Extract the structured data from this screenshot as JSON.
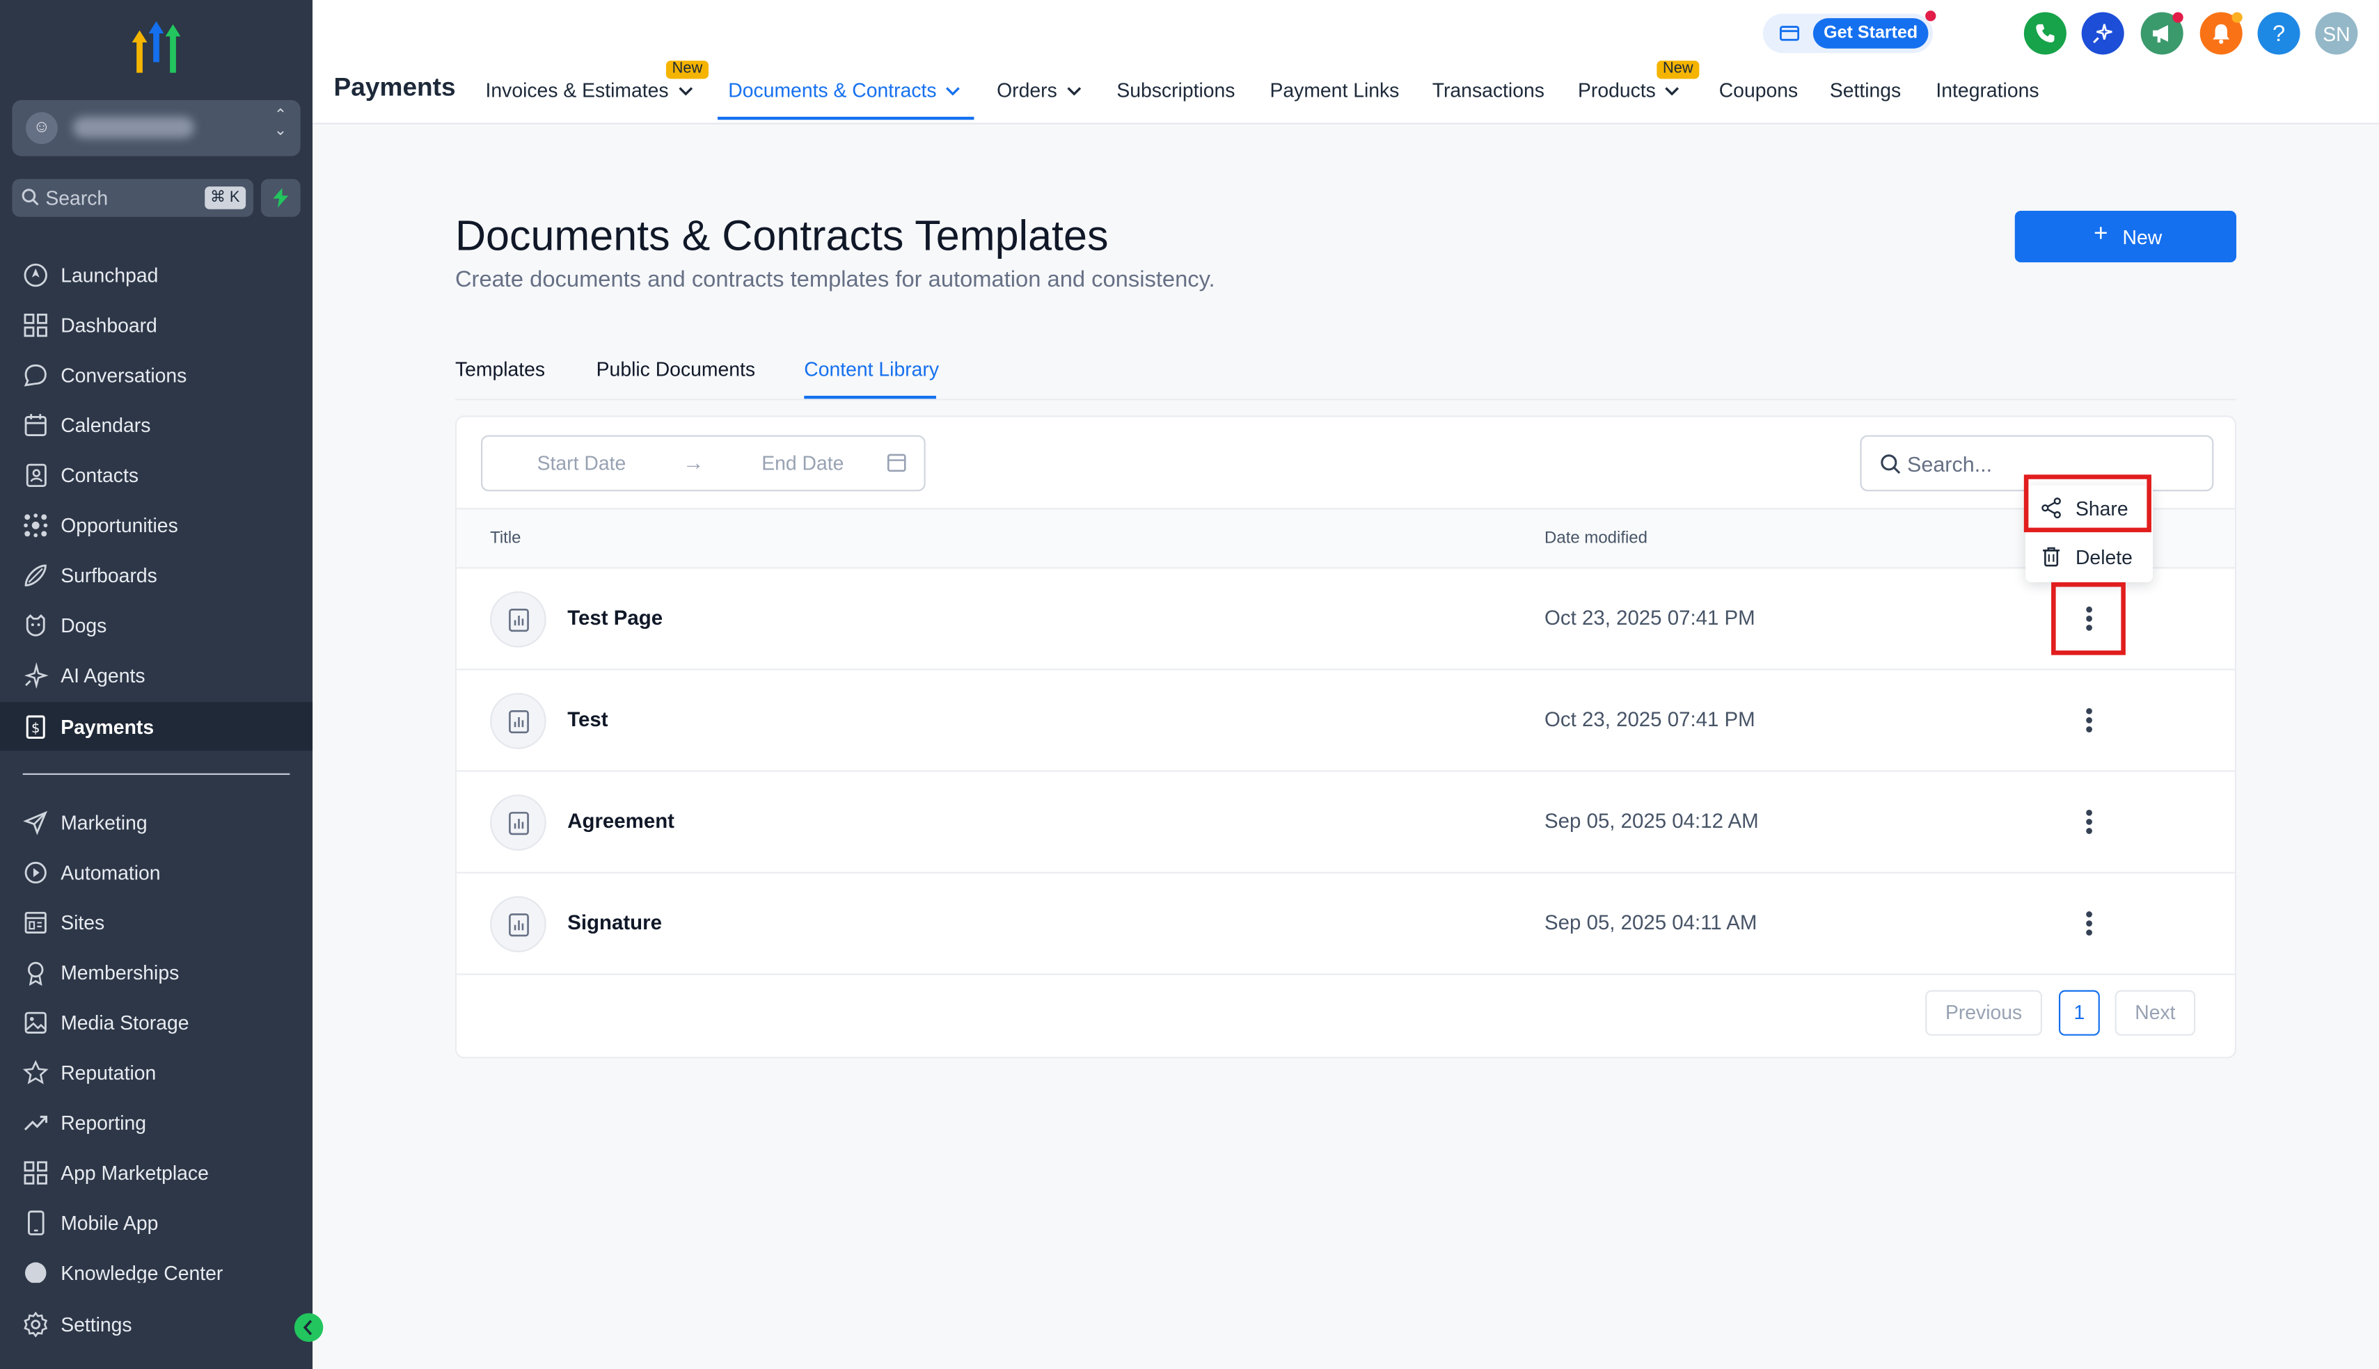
{
  "sidebar": {
    "search_label": "Search",
    "search_shortcut": "⌘ K",
    "items": [
      {
        "label": "Launchpad",
        "icon": "launchpad-icon"
      },
      {
        "label": "Dashboard",
        "icon": "dashboard-icon"
      },
      {
        "label": "Conversations",
        "icon": "chat-icon"
      },
      {
        "label": "Calendars",
        "icon": "calendar-icon"
      },
      {
        "label": "Contacts",
        "icon": "contacts-icon"
      },
      {
        "label": "Opportunities",
        "icon": "opportunities-icon"
      },
      {
        "label": "Surfboards",
        "icon": "surfboard-icon"
      },
      {
        "label": "Dogs",
        "icon": "dog-icon"
      },
      {
        "label": "AI Agents",
        "icon": "sparkle-icon"
      },
      {
        "label": "Payments",
        "icon": "payments-icon",
        "active": true
      }
    ],
    "items2": [
      {
        "label": "Marketing",
        "icon": "send-icon"
      },
      {
        "label": "Automation",
        "icon": "automation-icon"
      },
      {
        "label": "Sites",
        "icon": "sites-icon"
      },
      {
        "label": "Memberships",
        "icon": "award-icon"
      },
      {
        "label": "Media Storage",
        "icon": "image-icon"
      },
      {
        "label": "Reputation",
        "icon": "star-icon"
      },
      {
        "label": "Reporting",
        "icon": "trend-icon"
      },
      {
        "label": "App Marketplace",
        "icon": "grid-icon"
      },
      {
        "label": "Mobile App",
        "icon": "mobile-icon"
      },
      {
        "label": "Knowledge Center",
        "icon": "info-icon"
      }
    ],
    "settings_label": "Settings"
  },
  "header": {
    "module": "Payments",
    "tabs": [
      {
        "label": "Invoices & Estimates",
        "dropdown": true,
        "badge": "New"
      },
      {
        "label": "Documents & Contracts",
        "dropdown": true,
        "active": true
      },
      {
        "label": "Orders",
        "dropdown": true
      },
      {
        "label": "Subscriptions"
      },
      {
        "label": "Payment Links"
      },
      {
        "label": "Transactions"
      },
      {
        "label": "Products",
        "dropdown": true,
        "badge": "New"
      },
      {
        "label": "Coupons"
      },
      {
        "label": "Settings"
      },
      {
        "label": "Integrations"
      }
    ],
    "get_started": "Get Started",
    "help": "?",
    "avatar_initials": "SN",
    "colors": {
      "phone": "#16a34a",
      "ai": "#1d4ed8",
      "announce": "#3b9a6c",
      "bell": "#f97316",
      "help": "#1e88e5",
      "avatar": "#94b8c8"
    }
  },
  "page": {
    "title": "Documents & Contracts Templates",
    "subtitle": "Create documents and contracts templates for automation and consistency.",
    "new_button": "New",
    "subtabs": [
      "Templates",
      "Public Documents",
      "Content Library"
    ],
    "active_subtab": "Content Library"
  },
  "table": {
    "start_date_placeholder": "Start Date",
    "end_date_placeholder": "End Date",
    "search_placeholder": "Search...",
    "columns": [
      "Title",
      "Date modified"
    ],
    "rows": [
      {
        "title": "Test Page",
        "date": "Oct 23, 2025 07:41 PM"
      },
      {
        "title": "Test",
        "date": "Oct 23, 2025 07:41 PM"
      },
      {
        "title": "Agreement",
        "date": "Sep 05, 2025 04:12 AM"
      },
      {
        "title": "Signature",
        "date": "Sep 05, 2025 04:11 AM"
      }
    ],
    "pagination": {
      "previous": "Previous",
      "current": "1",
      "next": "Next"
    }
  },
  "row_menu": {
    "share": "Share",
    "delete": "Delete"
  },
  "accent_color": "#1570ef",
  "highlight_color": "#e11d1d"
}
